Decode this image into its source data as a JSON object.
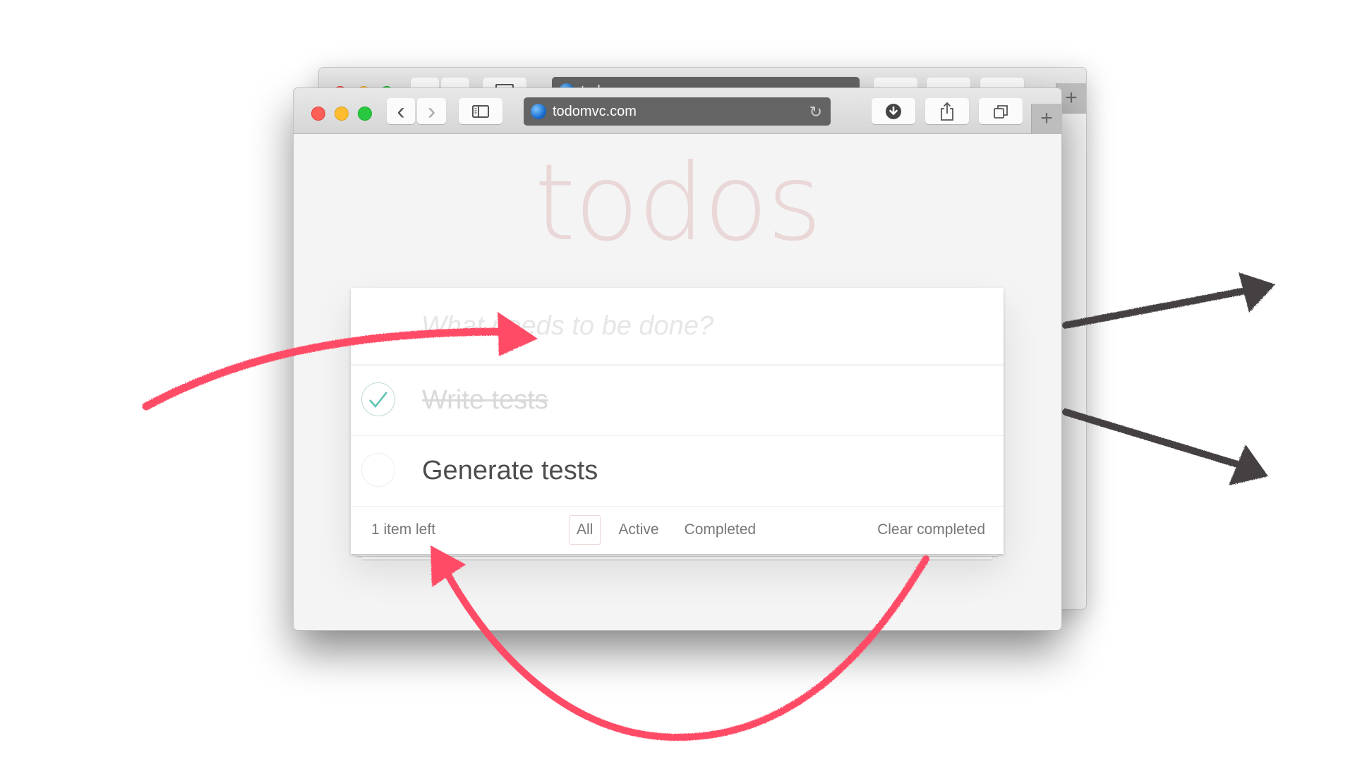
{
  "browser": {
    "url": "todomvc.com",
    "back_label": "‹",
    "forward_label": "›",
    "new_tab_label": "+",
    "reload_label": "↻"
  },
  "back_window": {
    "url": "todomvc.com"
  },
  "app": {
    "title": "todos",
    "new_todo_placeholder": "What needs to be done?",
    "new_todo_value": "",
    "todos": [
      {
        "label": "Write tests",
        "completed": true
      },
      {
        "label": "Generate tests",
        "completed": false
      }
    ],
    "footer": {
      "count_text": "1 item left",
      "filters": [
        "All",
        "Active",
        "Completed"
      ],
      "selected_filter": "All",
      "clear_completed": "Clear completed"
    }
  },
  "annotations": {
    "red_arrow_color": "#ff4b66",
    "dark_arrow_color": "#444042",
    "accent_check_color": "#5dc2af"
  }
}
